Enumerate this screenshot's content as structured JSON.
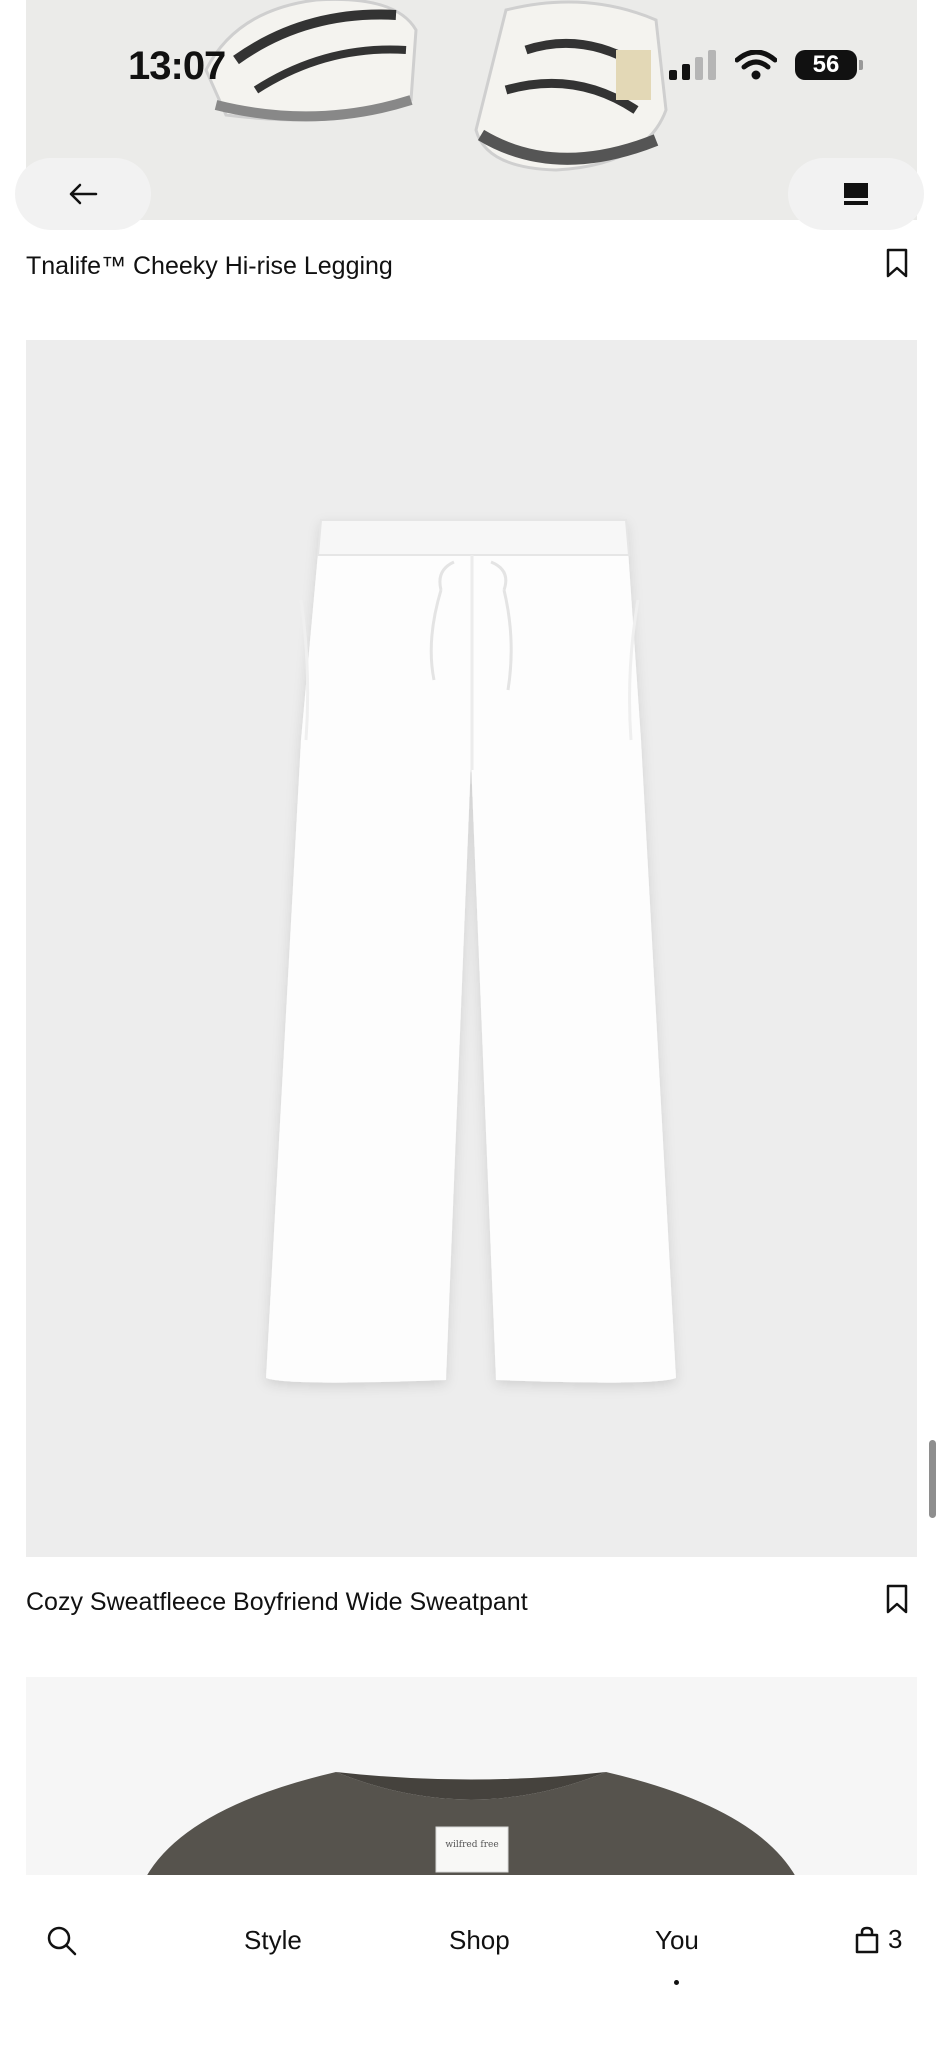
{
  "status_bar": {
    "time": "13:07",
    "battery": "56",
    "signal_icon": "cellular-signal-icon",
    "wifi_icon": "wifi-icon"
  },
  "header": {
    "back_icon": "arrow-left-icon",
    "menu_icon": "rectangle-view-icon"
  },
  "products": [
    {
      "title": "Tnalife™ Cheeky Hi-rise Legging",
      "bookmark_icon": "bookmark-icon"
    },
    {
      "title": "Cozy Sweatfleece Boyfriend Wide Sweatpant",
      "bookmark_icon": "bookmark-icon"
    },
    {
      "label_text": "wilfred free"
    }
  ],
  "bottom_nav": {
    "search_icon": "search-icon",
    "items": [
      "Style",
      "Shop",
      "You"
    ],
    "cart_icon": "shopping-bag-icon",
    "cart_count": "3",
    "active_item": "You"
  },
  "colors": {
    "background": "#ffffff",
    "image_bg": "#ededed",
    "text": "#111111"
  }
}
